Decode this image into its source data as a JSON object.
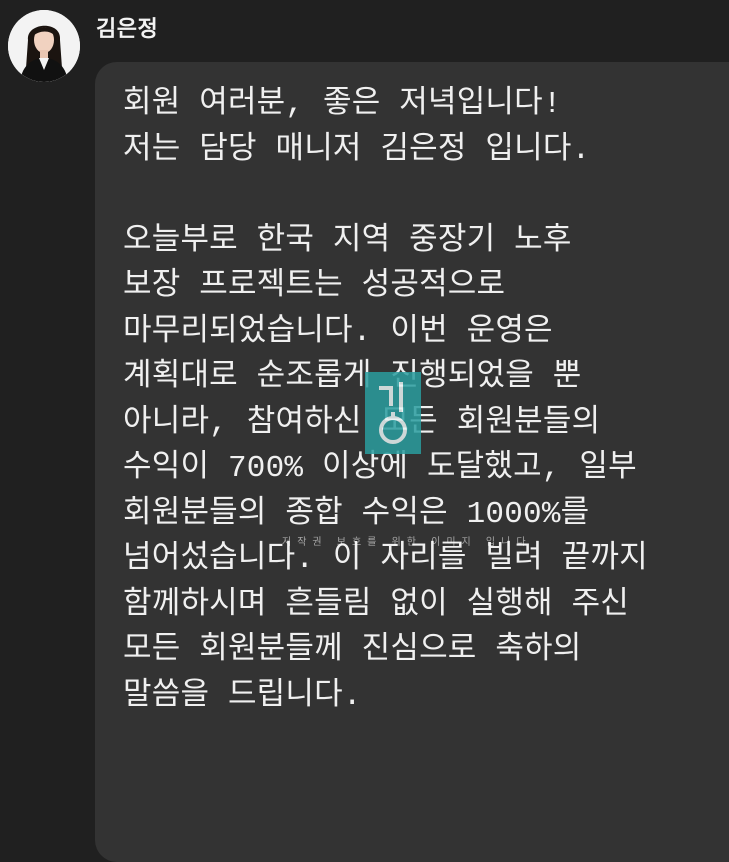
{
  "chat": {
    "sender": {
      "name": "김은정",
      "avatar": "profile-photo"
    },
    "message": {
      "lines": [
        "회원 여러분, 좋은 저녁입니다!",
        "저는 담당 매니저 김은정 입니다.",
        "",
        "오늘부로 한국 지역 중장기 노후",
        "보장 프로젝트는 성공적으로",
        "마무리되었습니다. 이번 운영은",
        "계획대로 순조롭게 진행되었을 뿐",
        "아니라, 참여하신 모든 회원분들의",
        "수익이 700% 이상에 도달했고, 일부",
        "회원분들의 종합 수익은 1000%를",
        "넘어섰습니다. 이 자리를 빌려 끝까지",
        "함께하시며 흔들림 없이 실행해 주신",
        "모든 회원분들께 진심으로 축하의",
        "말씀을 드립니다."
      ]
    },
    "watermark": {
      "text": "저작권 보호를 위한 이미지 입니다",
      "accent": "#2a9d9f"
    }
  },
  "colors": {
    "background": "#202020",
    "bubble": "#333333",
    "text": "#f0f0f0"
  }
}
